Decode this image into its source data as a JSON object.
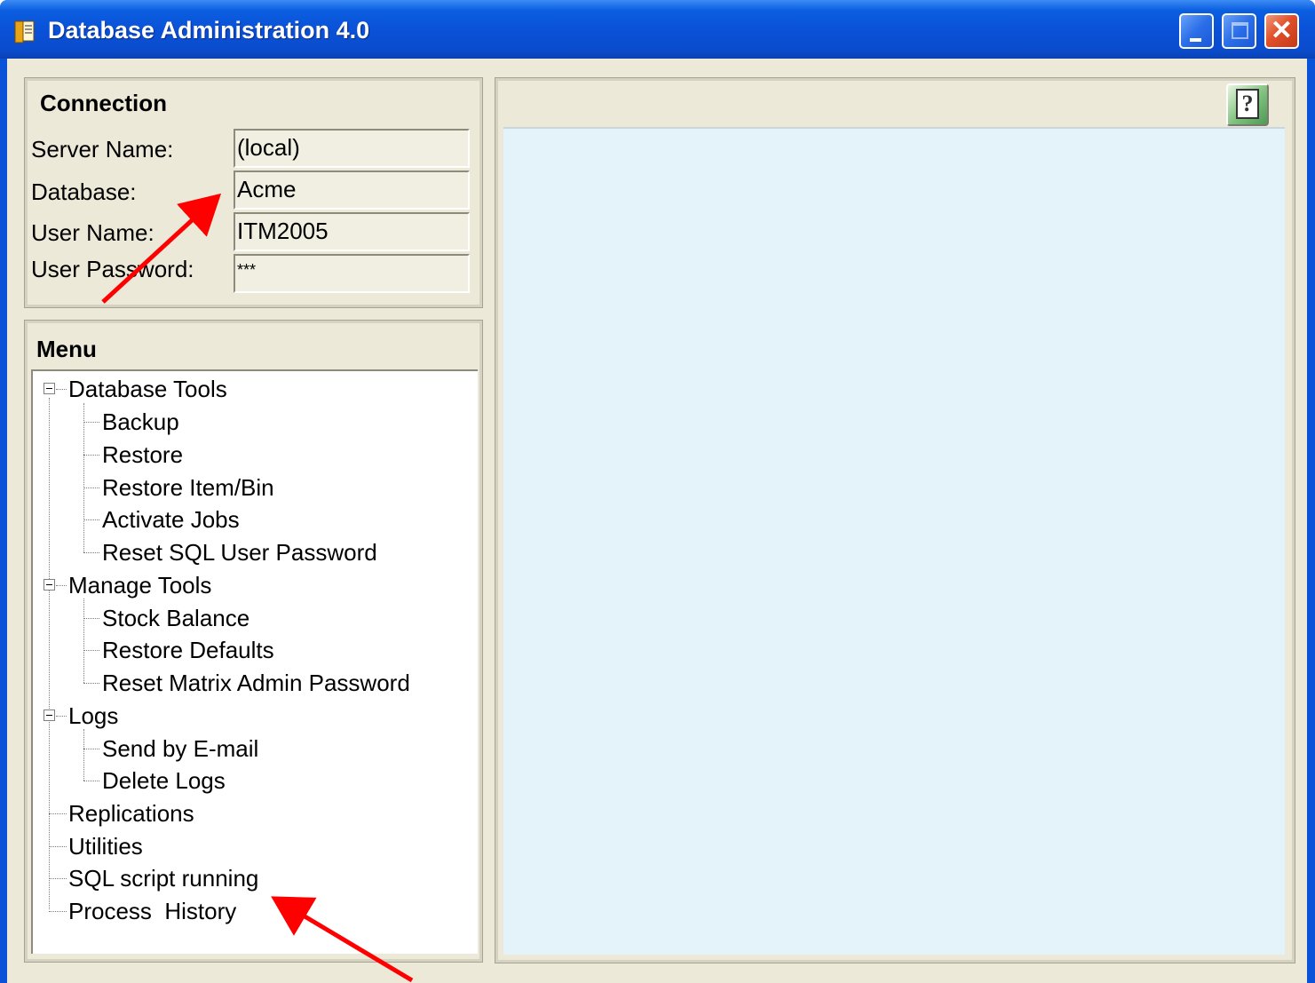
{
  "window": {
    "title": "Database Administration 4.0",
    "icon": "app-icon",
    "controls": {
      "minimize": "minimize-icon",
      "maximize": "maximize-icon",
      "close": "✕"
    }
  },
  "connection": {
    "title": "Connection",
    "fields": [
      {
        "label": "Server Name:",
        "value": "(local)"
      },
      {
        "label": "Database:",
        "value": "Acme"
      },
      {
        "label": "User Name:",
        "value": "ITM2005"
      },
      {
        "label": "User Password:",
        "value": "***"
      }
    ]
  },
  "menu": {
    "title": "Menu",
    "tree": {
      "database_tools": {
        "label": "Database Tools",
        "children": [
          "Backup",
          "Restore",
          "Restore Item/Bin",
          "Activate Jobs",
          "Reset SQL User Password"
        ]
      },
      "manage_tools": {
        "label": "Manage Tools",
        "children": [
          "Stock Balance",
          "Restore Defaults",
          "Reset Matrix Admin Password"
        ]
      },
      "logs": {
        "label": "Logs",
        "children": [
          "Send by E-mail",
          "Delete Logs"
        ]
      },
      "replications": "Replications",
      "utilities": "Utilities",
      "sql_script_running": "SQL script running",
      "process_history": "Process  History"
    }
  },
  "right_panel": {
    "help_button": "?"
  },
  "colors": {
    "titlebar": "#0a50d6",
    "client": "#ece9d8",
    "content_area": "#e4f2fa",
    "annotation_arrow": "#ff0000"
  }
}
